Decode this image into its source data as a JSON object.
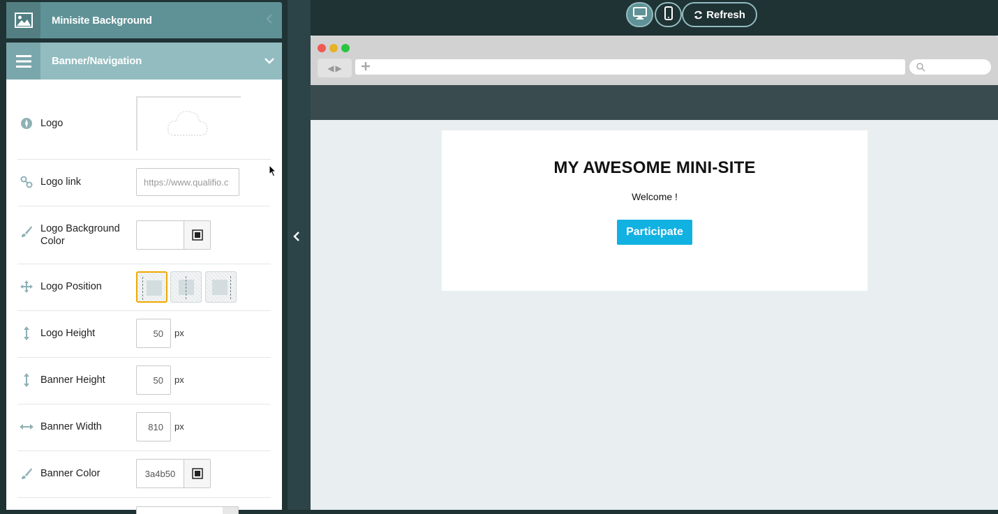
{
  "sidebar": {
    "sections": [
      {
        "title": "Minisite Background",
        "icon": "image-icon",
        "state": "collapsed"
      },
      {
        "title": "Banner/Navigation",
        "icon": "menu-icon",
        "state": "expanded"
      }
    ],
    "rows": {
      "logo": {
        "label": "Logo"
      },
      "logo_link": {
        "label": "Logo link",
        "value": "https://www.qualifio.c"
      },
      "logo_bg_color": {
        "label": "Logo Background Color",
        "value": ""
      },
      "logo_position": {
        "label": "Logo Position",
        "options": [
          "left",
          "center",
          "right"
        ],
        "selected": "left"
      },
      "logo_height": {
        "label": "Logo Height",
        "value": "50",
        "unit": "px"
      },
      "banner_height": {
        "label": "Banner Height",
        "value": "50",
        "unit": "px"
      },
      "banner_width": {
        "label": "Banner Width",
        "value": "810",
        "unit": "px"
      },
      "banner_color": {
        "label": "Banner Color",
        "value": "3a4b50"
      }
    }
  },
  "toolbar": {
    "refresh_label": "Refresh",
    "views": [
      "desktop-icon",
      "mobile-icon"
    ]
  },
  "preview": {
    "title": "MY AWESOME MINI-SITE",
    "welcome": "Welcome !",
    "button": "Participate",
    "banner_color": "#3a4b50",
    "button_color": "#11b1e2",
    "selected_accent": "#f0a800"
  }
}
